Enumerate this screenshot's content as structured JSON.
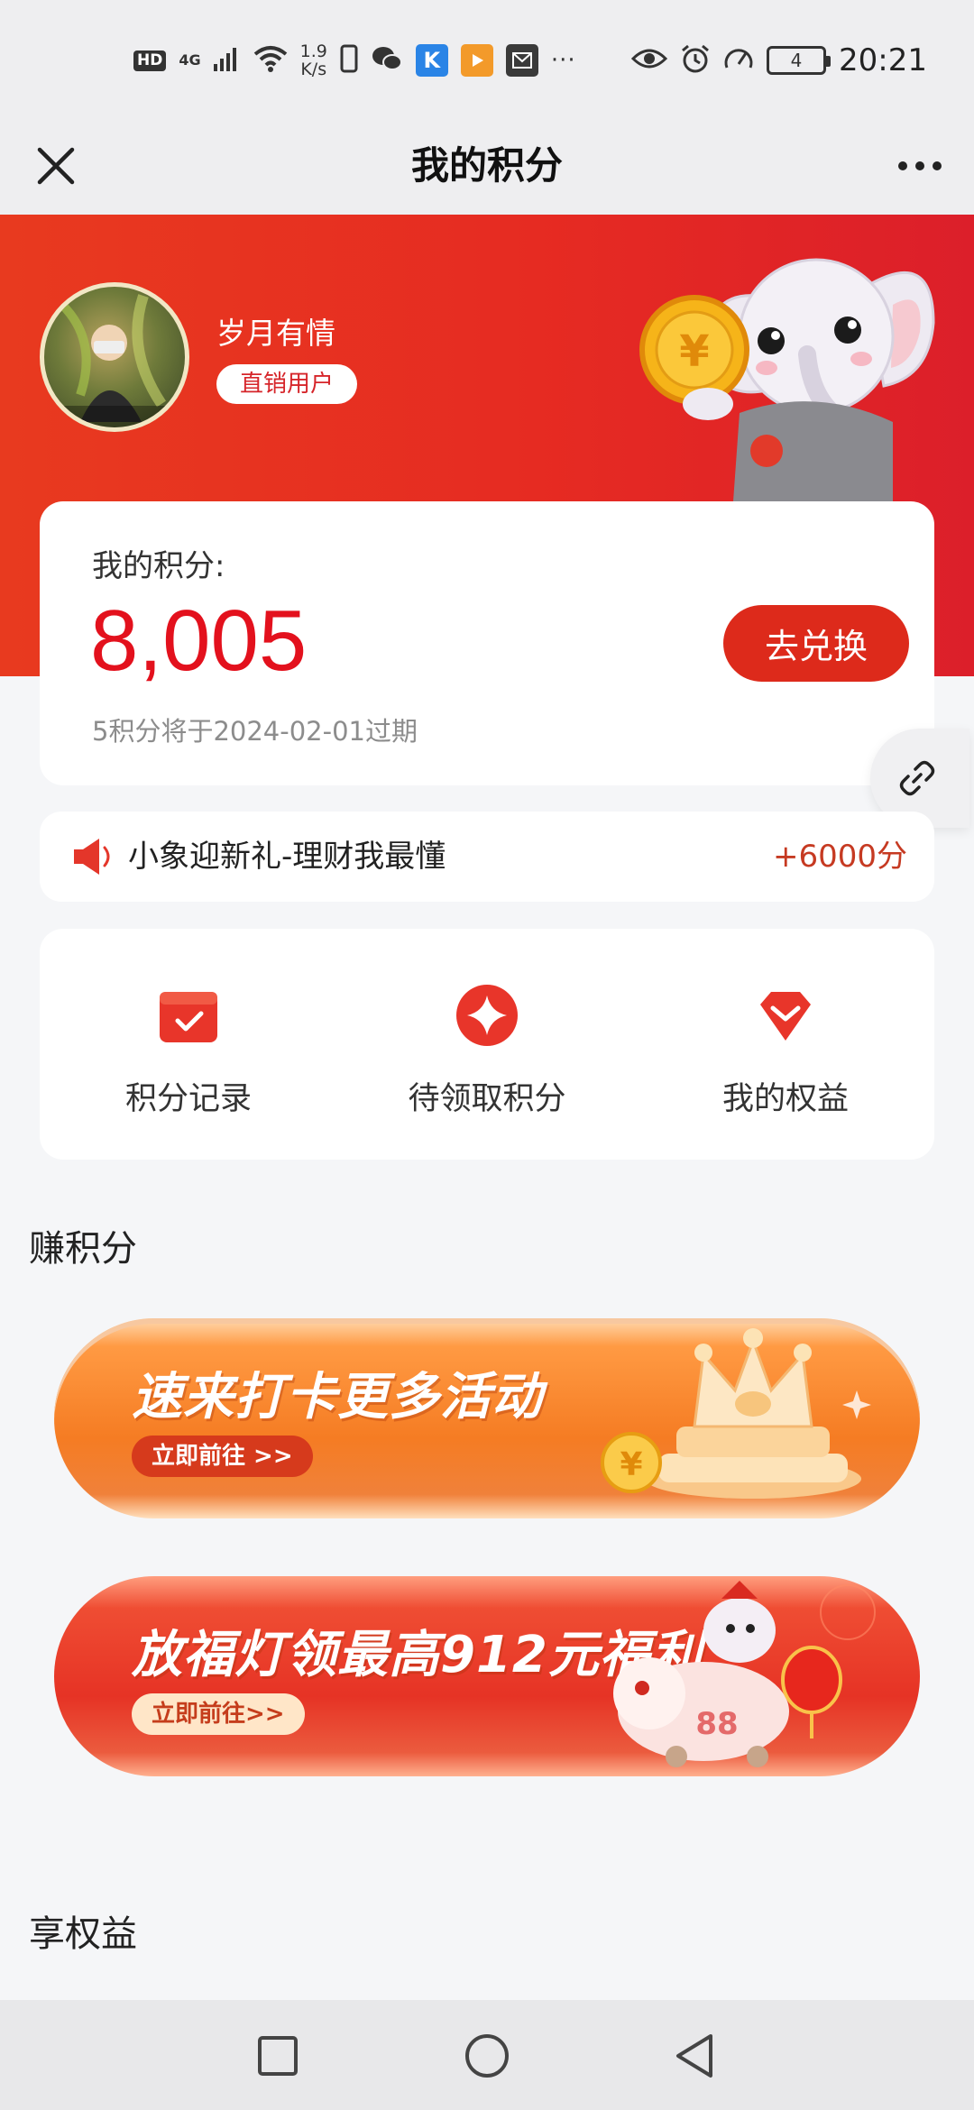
{
  "status_bar": {
    "network_hd": "HD",
    "network_type": "4G",
    "speed_value": "1.9",
    "speed_unit": "K/s",
    "more": "···",
    "battery_level": "4",
    "time": "20:21",
    "icons": [
      "hd-icon",
      "signal-icon",
      "wifi-icon",
      "phone-icon",
      "wechat-icon",
      "k-app-icon",
      "video-app-icon",
      "mail-app-icon",
      "eye-icon",
      "alarm-icon",
      "speed-icon",
      "battery-icon"
    ]
  },
  "nav": {
    "title": "我的积分",
    "close_icon": "close-icon",
    "more_icon": "more-icon"
  },
  "user": {
    "name": "岁月有情",
    "tag": "直销用户"
  },
  "points": {
    "label": "我的积分:",
    "value": "8,005",
    "exchange_label": "去兑换",
    "expire_note": "5积分将于2024-02-01过期"
  },
  "announcement": {
    "text": "小象迎新礼-理财我最懂",
    "points": "+6000分"
  },
  "quick_actions": [
    {
      "label": "积分记录",
      "icon": "calendar-check-icon"
    },
    {
      "label": "待领取积分",
      "icon": "sparkle-icon"
    },
    {
      "label": "我的权益",
      "icon": "diamond-icon"
    }
  ],
  "sections": {
    "earn": "赚积分",
    "benefits": "享权益"
  },
  "banners": [
    {
      "title": "速来打卡更多活动",
      "cta": "立即前往 >>"
    },
    {
      "title": "放福灯领最高912元福利",
      "cta": "立即前往>>"
    }
  ],
  "colors": {
    "brand_red": "#e3111d",
    "hero_red": "#e62b22",
    "button_red": "#dd2a1b",
    "banner_orange": "#f57c23"
  }
}
